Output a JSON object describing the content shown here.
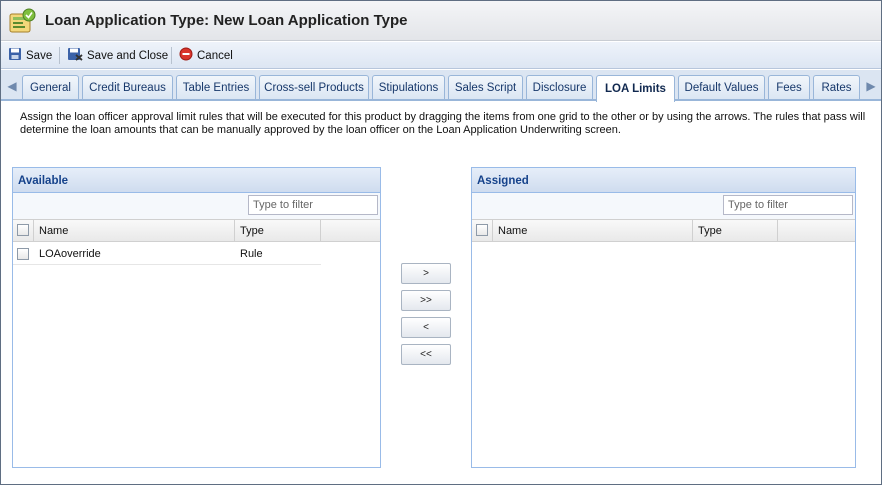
{
  "window": {
    "title": "Loan Application Type: New Loan Application Type"
  },
  "toolbar": {
    "save": "Save",
    "save_close": "Save and Close",
    "cancel": "Cancel"
  },
  "tabs": [
    {
      "label": "General"
    },
    {
      "label": "Credit Bureaus"
    },
    {
      "label": "Table Entries"
    },
    {
      "label": "Cross-sell Products"
    },
    {
      "label": "Stipulations"
    },
    {
      "label": "Sales Script"
    },
    {
      "label": "Disclosure"
    },
    {
      "label": "LOA Limits",
      "active": true
    },
    {
      "label": "Default Values"
    },
    {
      "label": "Fees"
    },
    {
      "label": "Rates"
    }
  ],
  "description": "Assign the loan officer approval limit rules that will be executed for this product by dragging the items from one grid to the other or by using the arrows. The rules that pass will determine the loan amounts that can be manually approved by the loan officer on the Loan Application Underwriting screen.",
  "available": {
    "title": "Available",
    "filter_placeholder": "Type to filter",
    "columns": {
      "name": "Name",
      "type": "Type"
    },
    "rows": [
      {
        "name": "LOAoverride",
        "type": "Rule"
      }
    ]
  },
  "assigned": {
    "title": "Assigned",
    "filter_placeholder": "Type to filter",
    "columns": {
      "name": "Name",
      "type": "Type"
    },
    "rows": []
  },
  "move_buttons": {
    "add": ">",
    "add_all": ">>",
    "remove": "<",
    "remove_all": "<<"
  },
  "colors": {
    "tab_text": "#17386b",
    "panel_header_text": "#15428b",
    "panel_border": "#99bbe8"
  }
}
